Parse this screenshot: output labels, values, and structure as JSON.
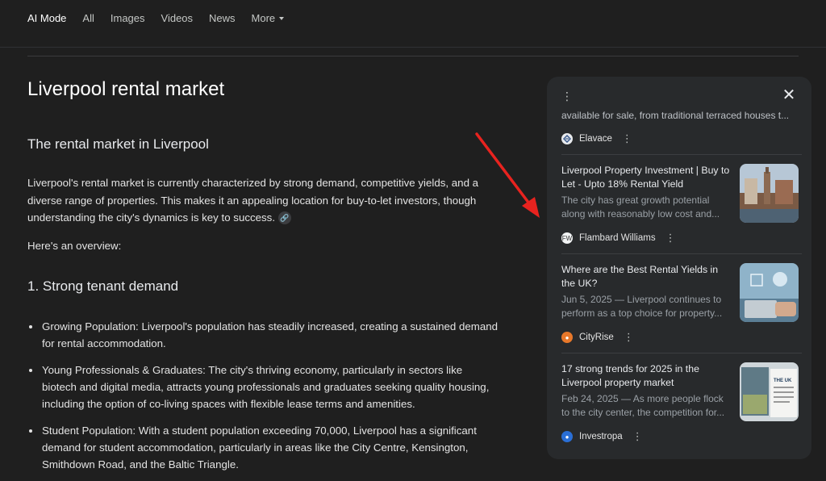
{
  "nav": {
    "items": [
      {
        "label": "AI Mode",
        "active": true
      },
      {
        "label": "All"
      },
      {
        "label": "Images"
      },
      {
        "label": "Videos"
      },
      {
        "label": "News"
      }
    ],
    "more_label": "More"
  },
  "main": {
    "title": "Liverpool rental market",
    "subtitle": "The rental market in Liverpool",
    "intro": "Liverpool's rental market is currently characterized by strong demand, competitive yields, and a diverse range of properties. This makes it an appealing location for buy-to-let investors, though understanding the city's dynamics is key to success.",
    "overview": "Here's an overview:",
    "section1_heading": "1. Strong tenant demand",
    "bullets": [
      "Growing Population: Liverpool's population has steadily increased, creating a sustained demand for rental accommodation.",
      "Young Professionals & Graduates: The city's thriving economy, particularly in sectors like biotech and digital media, attracts young professionals and graduates seeking quality housing, including the option of co-living spaces with flexible lease terms and amenities.",
      "Student Population: With a student population exceeding 70,000, Liverpool has a significant demand for student accommodation, particularly in areas like the City Centre, Kensington, Smithdown Road, and the Baltic Triangle."
    ]
  },
  "panel": {
    "top_snippet": "available for sale, from traditional terraced houses t...",
    "top_source": "Elavace",
    "cards": [
      {
        "title": "Liverpool Property Investment | Buy to Let - Upto 18% Rental Yield",
        "snippet_line1": "The city has great growth potential",
        "snippet_line2": "along with reasonably low cost and...",
        "source": "Flambard Williams"
      },
      {
        "title": "Where are the Best Rental Yields in the UK?",
        "snippet_line1": "Jun 5, 2025 — Liverpool continues to",
        "snippet_line2": "perform as a top choice for property...",
        "source": "CityRise"
      },
      {
        "title": "17 strong trends for 2025 in the Liverpool property market",
        "snippet_line1": "Feb 24, 2025 — As more people flock",
        "snippet_line2": "to the city center, the competition for...",
        "source": "Investropa",
        "thumb_text": "THE UK"
      }
    ]
  },
  "colors": {
    "background": "#1f1f1f",
    "panel": "#282a2c",
    "annotation_arrow": "#e8231f"
  }
}
